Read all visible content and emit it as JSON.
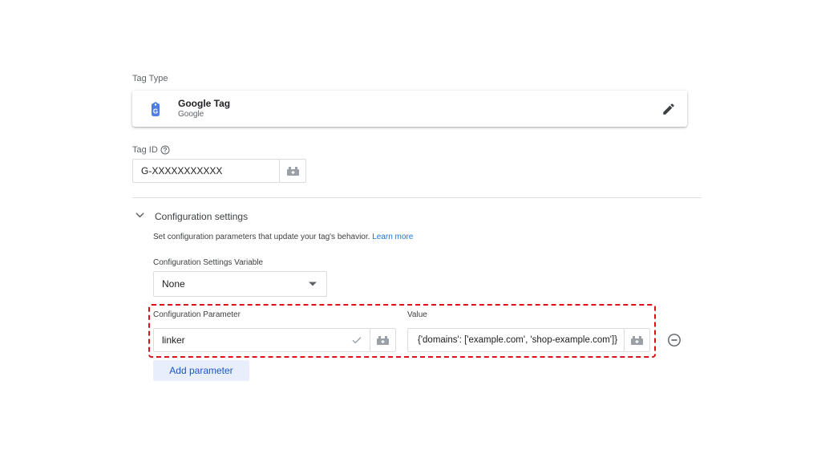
{
  "tag_type": {
    "label": "Tag Type",
    "name": "Google Tag",
    "vendor": "Google",
    "icon": "google-tag-icon",
    "edit_icon": "pencil-icon"
  },
  "tag_id": {
    "label": "Tag ID",
    "help_icon": "help-icon",
    "value": "G-XXXXXXXXXXX",
    "variable_icon": "variable-picker-icon"
  },
  "config": {
    "section_title": "Configuration settings",
    "description": "Set configuration parameters that update your tag's behavior.",
    "learn_more": "Learn more",
    "settings_variable_label": "Configuration Settings Variable",
    "settings_variable_value": "None",
    "param_label": "Configuration Parameter",
    "value_label": "Value",
    "param_value": "linker",
    "value_value": "{'domains': ['example.com', 'shop-example.com']}",
    "add_parameter": "Add parameter"
  },
  "colors": {
    "accent": "#1a73e8",
    "highlight_border": "#e0101a",
    "add_button_bg": "#e8eefc"
  }
}
